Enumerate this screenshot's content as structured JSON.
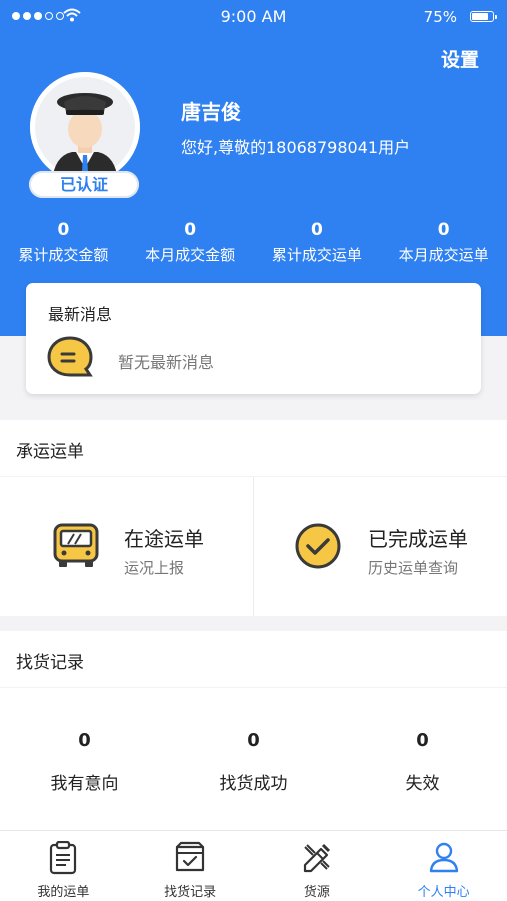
{
  "status_bar": {
    "time": "9:00 AM",
    "battery": "75%"
  },
  "header": {
    "settings_label": "设置"
  },
  "profile": {
    "name": "唐吉俊",
    "greeting": "您好,尊敬的18068798041用户",
    "badge": "已认证"
  },
  "stats": [
    {
      "value": "0",
      "label": "累计成交金额"
    },
    {
      "value": "0",
      "label": "本月成交金额"
    },
    {
      "value": "0",
      "label": "累计成交运单"
    },
    {
      "value": "0",
      "label": "本月成交运单"
    }
  ],
  "messages": {
    "title": "最新消息",
    "empty_text": "暂无最新消息"
  },
  "waybills": {
    "title": "承运运单",
    "in_transit": {
      "title": "在途运单",
      "subtitle": "运况上报"
    },
    "completed": {
      "title": "已完成运单",
      "subtitle": "历史运单查询"
    }
  },
  "search_records": {
    "title": "找货记录",
    "items": [
      {
        "value": "0",
        "label": "我有意向"
      },
      {
        "value": "0",
        "label": "找货成功"
      },
      {
        "value": "0",
        "label": "失效"
      }
    ]
  },
  "tabbar": {
    "items": [
      {
        "label": "我的运单",
        "icon": "clipboard-icon"
      },
      {
        "label": "找货记录",
        "icon": "box-check-icon"
      },
      {
        "label": "货源",
        "icon": "pencil-ruler-icon"
      },
      {
        "label": "个人中心",
        "icon": "person-icon"
      }
    ],
    "active": "个人中心"
  },
  "colors": {
    "primary": "#2f80f0",
    "accent_yellow": "#f6c744",
    "dark": "#3a3a3a"
  }
}
